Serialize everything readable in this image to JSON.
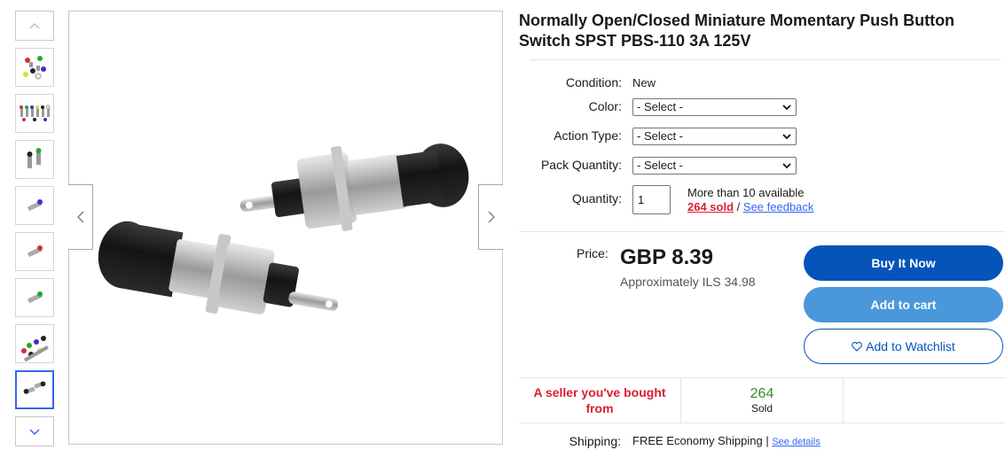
{
  "product": {
    "title": "Normally Open/Closed Miniature Momentary Push Button Switch SPST PBS-110 3A 125V"
  },
  "details": {
    "condition_label": "Condition:",
    "condition_value": "New",
    "color_label": "Color:",
    "color_select": "- Select -",
    "action_label": "Action Type:",
    "action_select": "- Select -",
    "pack_label": "Pack Quantity:",
    "pack_select": "- Select -",
    "quantity_label": "Quantity:",
    "quantity_value": "1",
    "availability": "More than 10 available",
    "sold_link": "264 sold",
    "separator": "/",
    "feedback_link": "See feedback"
  },
  "pricing": {
    "price_label": "Price:",
    "price": "GBP 8.39",
    "approx": "Approximately ILS 34.98"
  },
  "buttons": {
    "buy_now": "Buy It Now",
    "add_to_cart": "Add to cart",
    "watchlist": "Add to Watchlist"
  },
  "stats": {
    "seller_line1": "A seller you've bought",
    "seller_line2": "from",
    "sold_count": "264",
    "sold_label": "Sold"
  },
  "shipping": {
    "label": "Shipping:",
    "value": "FREE Economy Shipping",
    "divider": "|",
    "see_details": "See details"
  },
  "colors": {
    "link_blue": "#3665f3",
    "buy_blue": "#0654ba",
    "cart_blue": "#4a98d9",
    "sold_red": "#dd1e31",
    "stat_green": "#3c8a2e"
  },
  "icons": {
    "thumb_up": "chevron-up-icon",
    "thumb_down": "chevron-down-icon",
    "image_prev": "chevron-left-icon",
    "image_next": "chevron-right-icon",
    "select": "chevron-down-icon",
    "watch": "heart-icon"
  }
}
